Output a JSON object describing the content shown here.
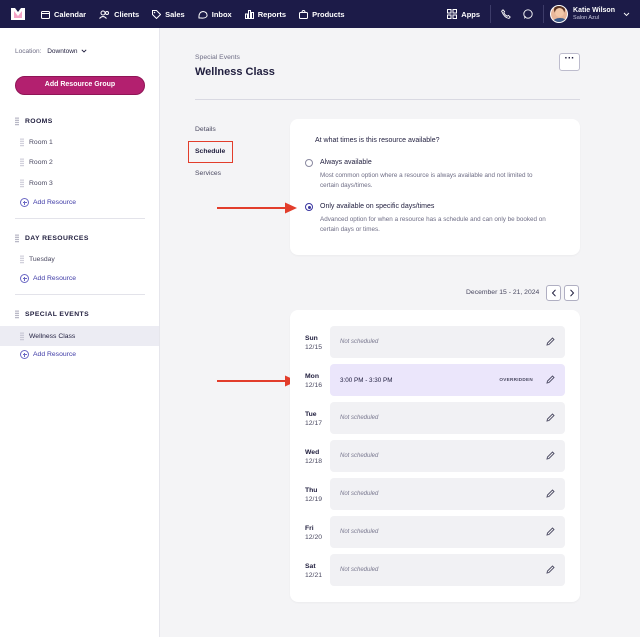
{
  "nav": {
    "items": [
      {
        "label": "Calendar",
        "icon": "calendar-icon"
      },
      {
        "label": "Clients",
        "icon": "clients-icon"
      },
      {
        "label": "Sales",
        "icon": "sales-tag-icon"
      },
      {
        "label": "Inbox",
        "icon": "inbox-icon"
      },
      {
        "label": "Reports",
        "icon": "reports-bar-icon"
      },
      {
        "label": "Products",
        "icon": "products-bag-icon"
      }
    ],
    "apps_label": "Apps",
    "user": {
      "name": "Katie Wilson",
      "business": "Salon Azul"
    },
    "colors": {
      "bar": "#1c1b48"
    }
  },
  "sidebar": {
    "location_label": "Location:",
    "location_value": "Downtown",
    "add_group_label": "Add Resource Group",
    "sections": [
      {
        "title": "ROOMS",
        "items": [
          "Room 1",
          "Room 2",
          "Room 3"
        ],
        "add_label": "Add Resource"
      },
      {
        "title": "DAY RESOURCES",
        "items": [
          "Tuesday"
        ],
        "add_label": "Add Resource"
      },
      {
        "title": "SPECIAL EVENTS",
        "items": [
          "Wellness Class"
        ],
        "add_label": "Add Resource"
      }
    ],
    "accent": "#b3206f"
  },
  "main": {
    "breadcrumb": "Special Events",
    "title": "Wellness Class",
    "more_label": "···",
    "tabs": [
      "Details",
      "Schedule",
      "Services"
    ],
    "selected_tab": "Schedule",
    "availability": {
      "question": "At what times is this resource available?",
      "options": [
        {
          "title": "Always available",
          "description": "Most common option where a resource is always available and not limited to certain days/times.",
          "selected": false
        },
        {
          "title": "Only available on specific days/times",
          "description": "Advanced option for when a resource has a schedule and can only be booked on certain days or times.",
          "selected": true
        }
      ]
    },
    "schedule": {
      "week_range": "December 15 - 21, 2024",
      "days": [
        {
          "day": "Sun",
          "date": "12/15",
          "text": "Not scheduled",
          "badge": ""
        },
        {
          "day": "Mon",
          "date": "12/16",
          "text": "3:00 PM - 3:30 PM",
          "badge": "OVERRIDDEN"
        },
        {
          "day": "Tue",
          "date": "12/17",
          "text": "Not scheduled",
          "badge": ""
        },
        {
          "day": "Wed",
          "date": "12/18",
          "text": "Not scheduled",
          "badge": ""
        },
        {
          "day": "Thu",
          "date": "12/19",
          "text": "Not scheduled",
          "badge": ""
        },
        {
          "day": "Fri",
          "date": "12/20",
          "text": "Not scheduled",
          "badge": ""
        },
        {
          "day": "Sat",
          "date": "12/21",
          "text": "Not scheduled",
          "badge": ""
        }
      ]
    },
    "annotation_color": "#e23d2b"
  }
}
